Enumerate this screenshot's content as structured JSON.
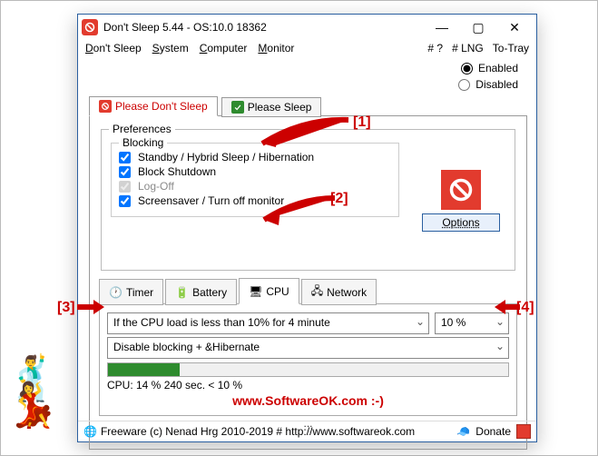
{
  "window": {
    "title": "Don't Sleep 5.44 - OS:10.0 18362"
  },
  "menu": {
    "dont_sleep": "Don't Sleep",
    "system": "System",
    "computer": "Computer",
    "monitor": "Monitor",
    "hashq": "# ?",
    "lng": "# LNG",
    "totray": "To-Tray"
  },
  "mode": {
    "enabled": "Enabled",
    "disabled": "Disabled"
  },
  "tabs": {
    "dont": "Please Don't Sleep",
    "do": "Please Sleep"
  },
  "prefs": {
    "legend": "Preferences",
    "blocking_legend": "Blocking",
    "standby": "Standby / Hybrid Sleep / Hibernation",
    "shutdown": "Block Shutdown",
    "logoff": "Log-Off",
    "screensaver": "Screensaver / Turn off monitor",
    "options_btn": "Options"
  },
  "subtabs": {
    "timer": "Timer",
    "battery": "Battery",
    "cpu": "CPU",
    "network": "Network"
  },
  "cpu_panel": {
    "condition": "If the CPU load is less than 10% for 4 minute",
    "percent": "10 %",
    "action": "Disable blocking + &Hibernate",
    "status": "CPU: 14 % 240 sec. < 10 %"
  },
  "site_text": "www.SoftwareOK.com :-)",
  "dots": "...",
  "status": {
    "text": "Freeware (c) Nenad Hrg 2010-2019 # http://www.softwareok.com",
    "donate": "Donate"
  },
  "ann": {
    "n1": "[1]",
    "n2": "[2]",
    "n3": "[3]",
    "n4": "[4]"
  }
}
